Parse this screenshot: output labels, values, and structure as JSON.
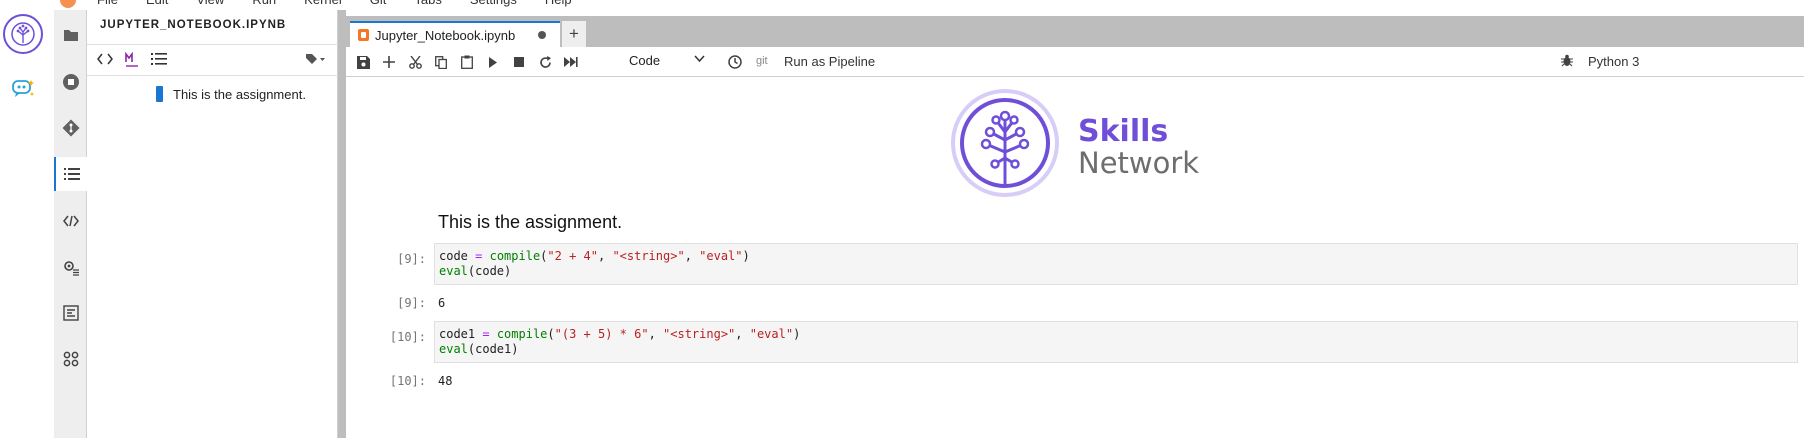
{
  "menu": {
    "items": [
      "File",
      "Edit",
      "View",
      "Run",
      "Kernel",
      "Git",
      "Tabs",
      "Settings",
      "Help"
    ]
  },
  "toc": {
    "title": "JUPYTER_NOTEBOOK.IPYNB",
    "entries": [
      {
        "label": "This is the assignment."
      }
    ]
  },
  "tab": {
    "label": "Jupyter_Notebook.ipynb",
    "new_tab_label": "+"
  },
  "toolbar": {
    "cell_type": "Code",
    "git_label": "git",
    "pipeline_label": "Run as Pipeline",
    "kernel_label": "Python 3"
  },
  "logo": {
    "line1": "Skills",
    "line2": "Network",
    "accent": "#6f4fd8",
    "gray": "#6d6d6d"
  },
  "notebook": {
    "markdown": "This is the assignment.",
    "cells": [
      {
        "in_prompt": "[9]:",
        "code_lines": [
          [
            {
              "t": "code ",
              "c": ""
            },
            {
              "t": "=",
              "c": "op"
            },
            {
              "t": " ",
              "c": ""
            },
            {
              "t": "compile",
              "c": "bi"
            },
            {
              "t": "(",
              "c": ""
            },
            {
              "t": "\"2 + 4\"",
              "c": "st"
            },
            {
              "t": ", ",
              "c": ""
            },
            {
              "t": "\"<string>\"",
              "c": "st"
            },
            {
              "t": ", ",
              "c": ""
            },
            {
              "t": "\"eval\"",
              "c": "st"
            },
            {
              "t": ")",
              "c": ""
            }
          ],
          [
            {
              "t": "eval",
              "c": "bi"
            },
            {
              "t": "(code)",
              "c": ""
            }
          ]
        ],
        "out_prompt": "[9]:",
        "output": "6"
      },
      {
        "in_prompt": "[10]:",
        "code_lines": [
          [
            {
              "t": "code1 ",
              "c": ""
            },
            {
              "t": "=",
              "c": "op"
            },
            {
              "t": " ",
              "c": ""
            },
            {
              "t": "compile",
              "c": "bi"
            },
            {
              "t": "(",
              "c": ""
            },
            {
              "t": "\"(3 + 5) * 6\"",
              "c": "st"
            },
            {
              "t": ", ",
              "c": ""
            },
            {
              "t": "\"<string>\"",
              "c": "st"
            },
            {
              "t": ", ",
              "c": ""
            },
            {
              "t": "\"eval\"",
              "c": "st"
            },
            {
              "t": ")",
              "c": ""
            }
          ],
          [
            {
              "t": "eval",
              "c": "bi"
            },
            {
              "t": "(code1)",
              "c": ""
            }
          ]
        ],
        "out_prompt": "[10]:",
        "output": "48"
      }
    ]
  },
  "colors": {
    "brand_blue": "#1976d2",
    "jupyter_orange": "#f37726"
  }
}
